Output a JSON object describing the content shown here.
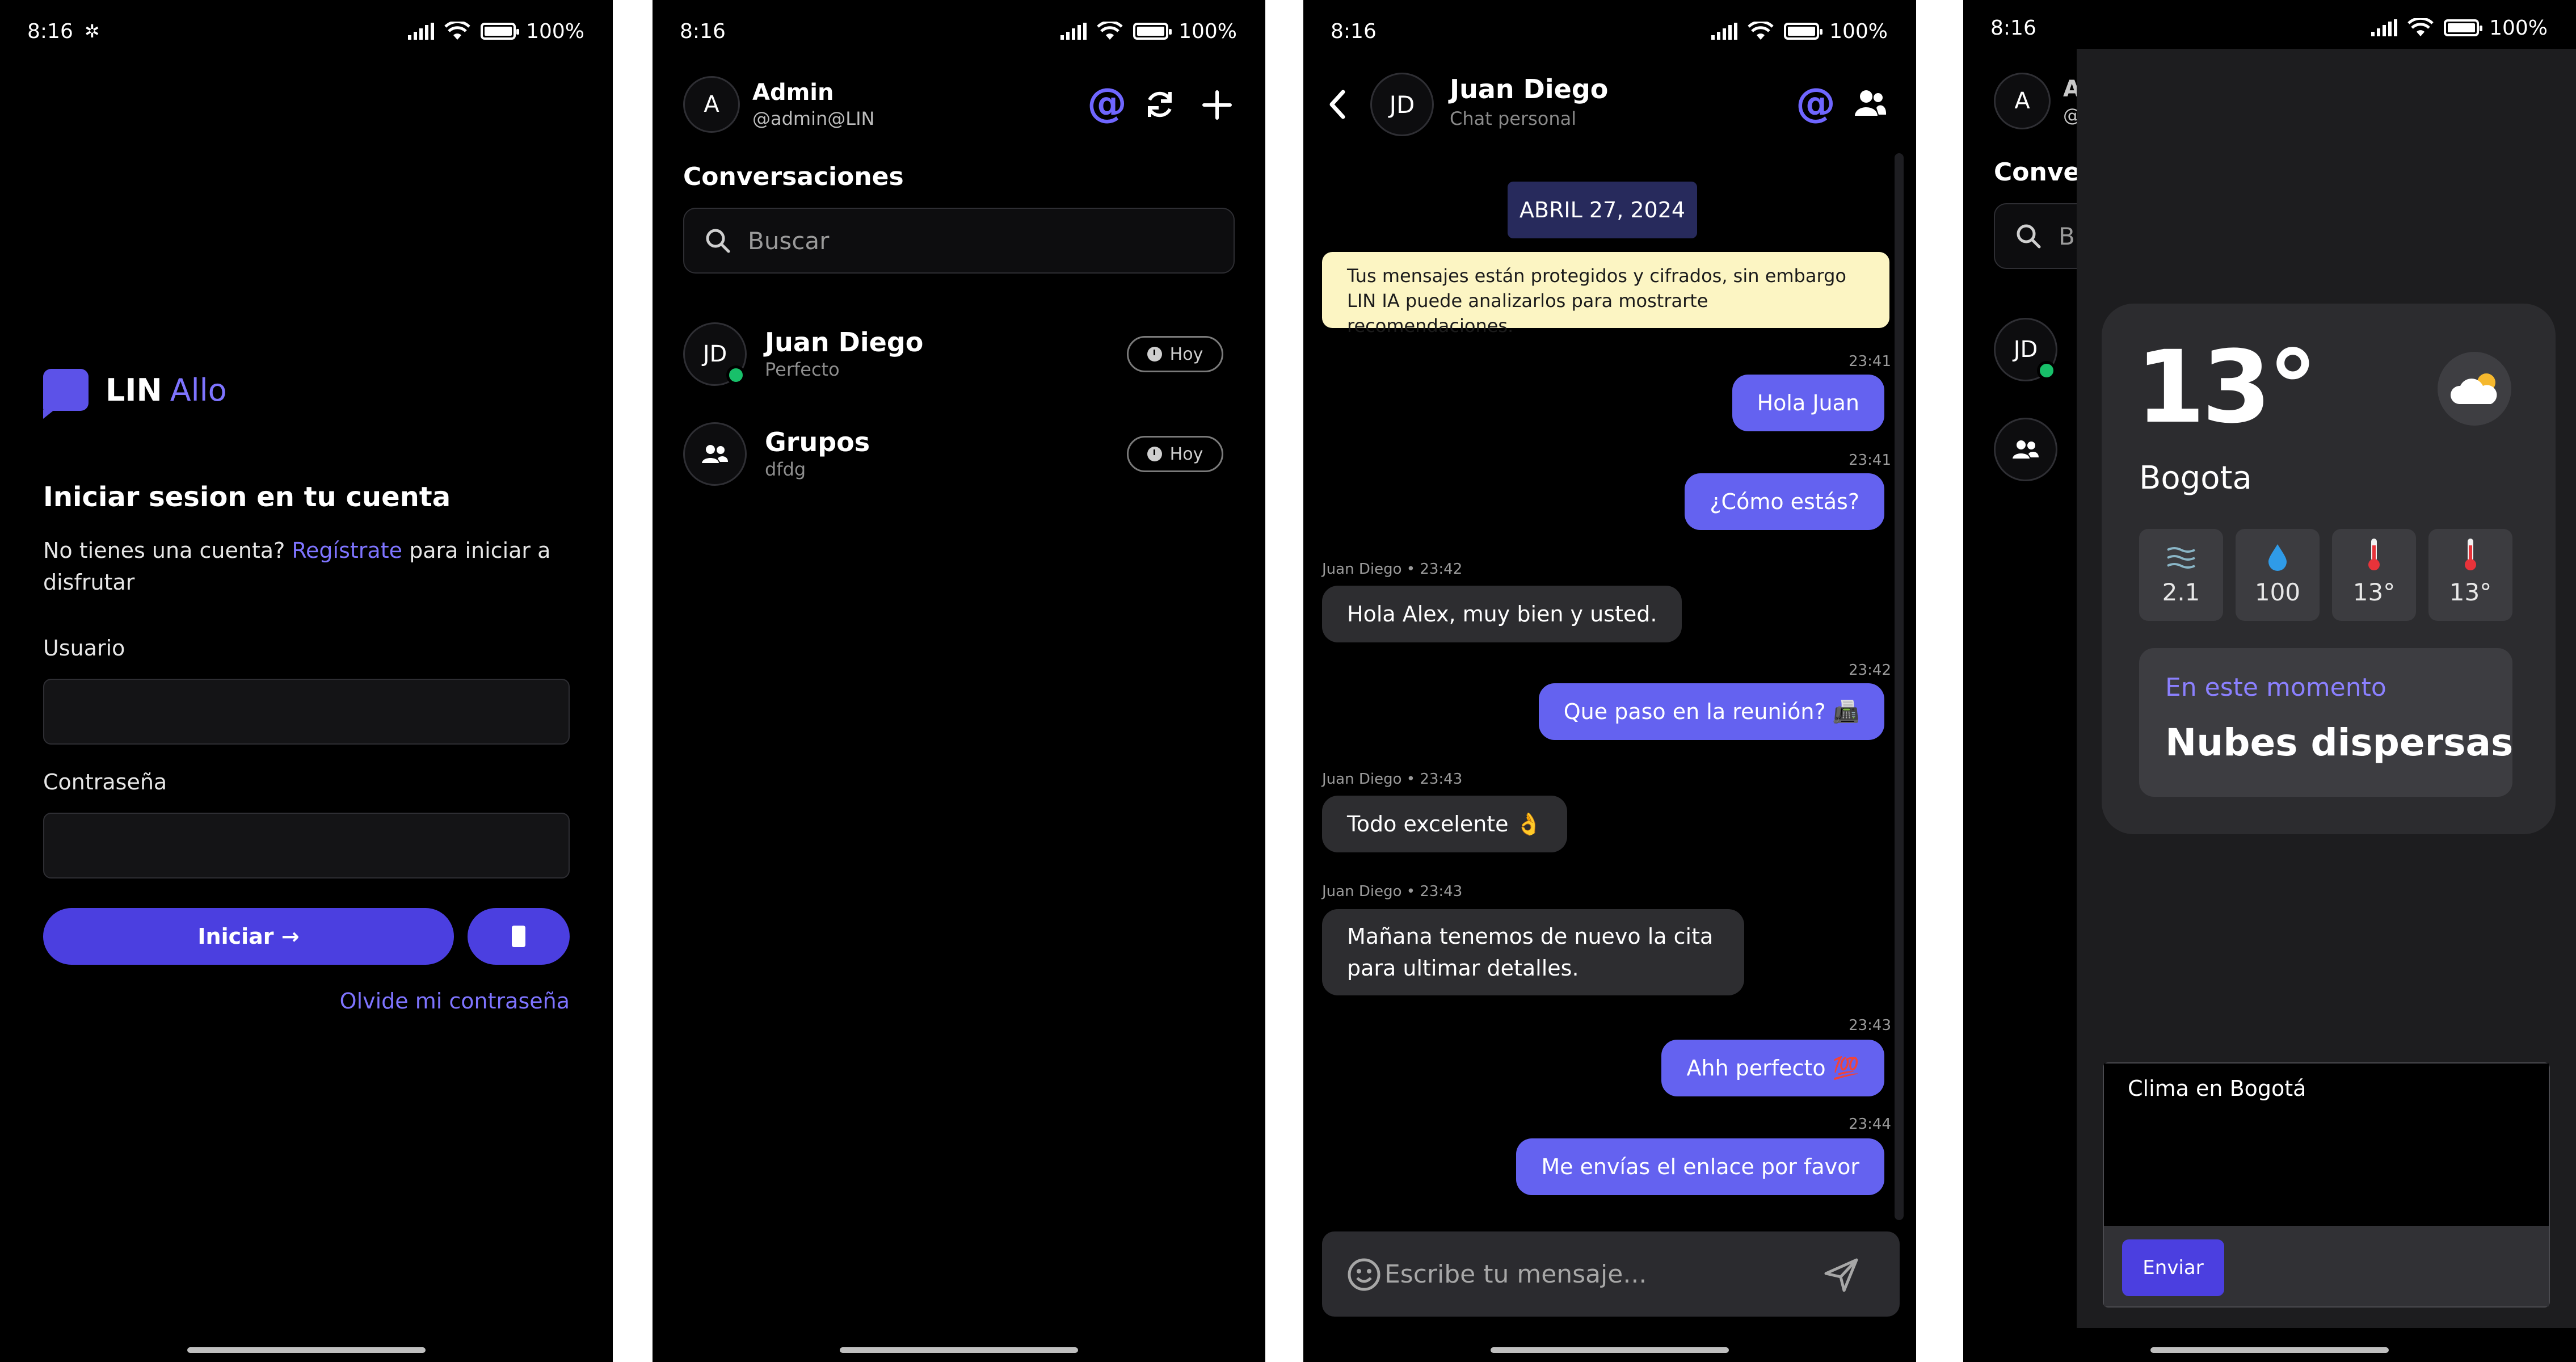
{
  "status": {
    "time": "8:16",
    "battery": "100%"
  },
  "login": {
    "brand_a": "LIN",
    "brand_b": "Allo",
    "title": "Iniciar sesion en tu cuenta",
    "sub_prefix": "No tienes una cuenta?",
    "sub_link": "Regístrate",
    "sub_suffix": "para iniciar a disfrutar",
    "user_label": "Usuario",
    "pass_label": "Contraseña",
    "submit": "Iniciar →",
    "forgot": "Olvide mi contraseña"
  },
  "list": {
    "avatar": "A",
    "user": "Admin",
    "handle": "@admin@LIN",
    "section": "Conversaciones",
    "search_placeholder": "Buscar",
    "conversations": [
      {
        "initials": "JD",
        "name": "Juan Diego",
        "preview": "Perfecto",
        "when": "Hoy",
        "online": true
      },
      {
        "initials": "",
        "name": "Grupos",
        "preview": "dfdg",
        "when": "Hoy",
        "online": false
      }
    ]
  },
  "chat": {
    "initials": "JD",
    "name": "Juan Diego",
    "subtitle": "Chat personal",
    "date": "ABRIL 27, 2024",
    "notice": "Tus mensajes están protegidos y cifrados, sin embargo LIN IA puede analizarlos para mostrarte recomendaciones.",
    "messages": [
      {
        "dir": "out",
        "meta": "23:41",
        "text": "Hola Juan"
      },
      {
        "dir": "out",
        "meta": "23:41",
        "text": "¿Cómo estás?"
      },
      {
        "dir": "in",
        "meta": "Juan Diego • 23:42",
        "text": "Hola Alex, muy bien y usted."
      },
      {
        "dir": "out",
        "meta": "23:42",
        "text": "Que paso en la reunión? 📠"
      },
      {
        "dir": "in",
        "meta": "Juan Diego • 23:43",
        "text": "Todo excelente 👌"
      },
      {
        "dir": "in",
        "meta": "Juan Diego • 23:43",
        "text": "Mañana tenemos de nuevo la cita para ultimar detalles."
      },
      {
        "dir": "out",
        "meta": "23:43",
        "text": "Ahh perfecto 💯"
      },
      {
        "dir": "out",
        "meta": "23:44",
        "text": "Me envías el enlace por favor"
      }
    ],
    "composer_placeholder": "Escribe tu mensaje..."
  },
  "weather": {
    "temp": "13°",
    "city": "Bogota",
    "stats": [
      {
        "icon": "wind-icon",
        "value": "2.1"
      },
      {
        "icon": "drop-icon",
        "value": "100"
      },
      {
        "icon": "thermometer-icon",
        "value": "13°"
      },
      {
        "icon": "thermometer-icon",
        "value": "13°"
      }
    ],
    "now_label": "En este momento",
    "now_value": "Nubes dispersas",
    "prompt": "Clima en Bogotá",
    "send": "Enviar",
    "bg_avatar": "A",
    "bg_user_fragment": "A",
    "bg_handle_fragment": "@",
    "bg_section_fragment": "Conver",
    "bg_search_fragment": "Bu",
    "bg_initials": "JD"
  },
  "colors": {
    "accent": "#4b3fe0",
    "accent_light": "#7e74ff",
    "bubble_out": "#6462f0",
    "bubble_in": "#2d2d30",
    "online": "#18c06a"
  }
}
